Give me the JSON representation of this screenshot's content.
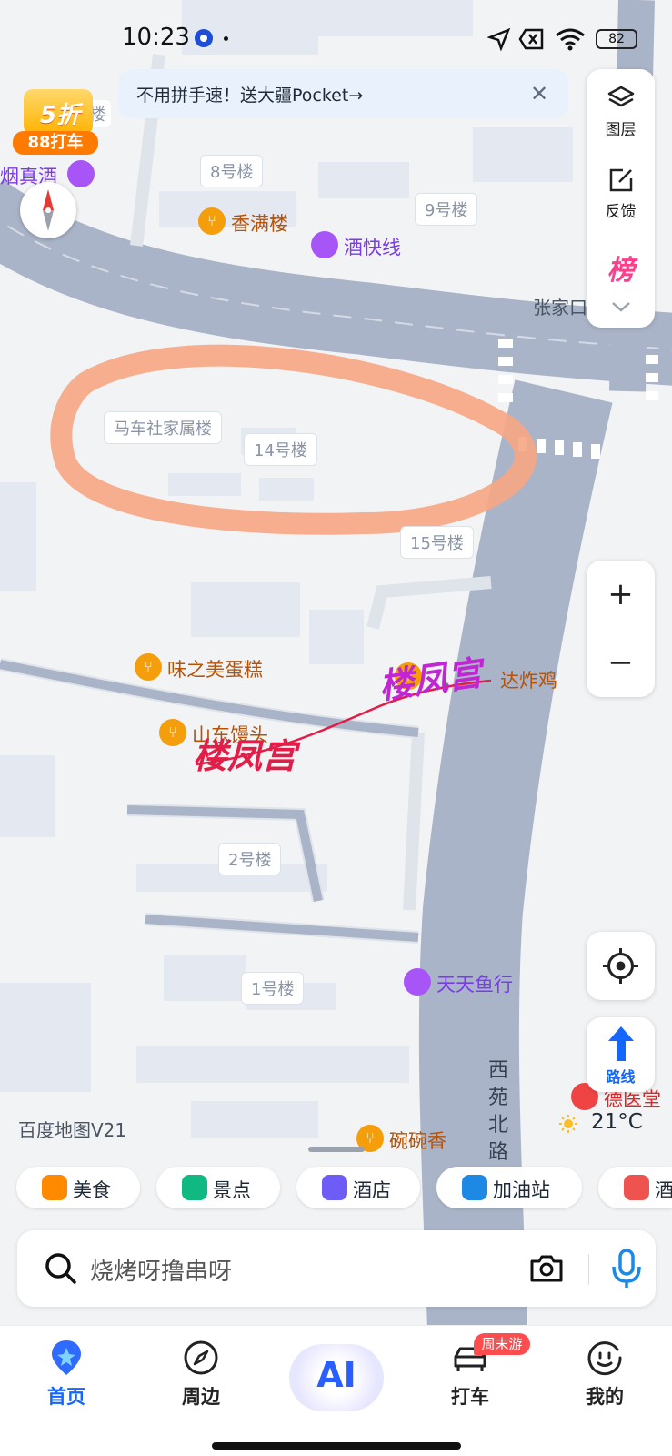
{
  "status": {
    "time": "10:23",
    "battery": "82"
  },
  "promo": {
    "discount": "5折",
    "label": "88打车"
  },
  "banner": {
    "text": "不用拼手速！送大疆Pocket→",
    "close": "✕"
  },
  "side_panel": {
    "layers_label": "图层",
    "feedback_label": "反馈",
    "rank_label": "榜"
  },
  "map": {
    "buildings": [
      {
        "name": "8号楼"
      },
      {
        "name": "9号楼"
      },
      {
        "name": "马车社家属楼"
      },
      {
        "name": "14号楼"
      },
      {
        "name": "15号楼"
      },
      {
        "name": "2号楼"
      },
      {
        "name": "1号楼"
      },
      {
        "name": "楼"
      }
    ],
    "pois": [
      {
        "name": "烟真酒"
      },
      {
        "name": "香满楼"
      },
      {
        "name": "酒快线"
      },
      {
        "name": "味之美蛋糕"
      },
      {
        "name": "山东馒头"
      },
      {
        "name": "达炸鸡"
      },
      {
        "name": "天天鱼行"
      },
      {
        "name": "德医堂"
      },
      {
        "name": "碗碗香"
      }
    ],
    "roads": [
      {
        "name": "张家口"
      },
      {
        "name": "西苑北路"
      }
    ],
    "annotations": [
      {
        "text": "楼凤宫"
      },
      {
        "text": "楼凤宫"
      }
    ]
  },
  "zoom": {
    "in": "+",
    "out": "−"
  },
  "route": {
    "label": "路线"
  },
  "weather": {
    "temp": "21°C"
  },
  "scale": {
    "text": "百度地图V21"
  },
  "chips": [
    {
      "label": "美食",
      "color": "#ff8a00"
    },
    {
      "label": "景点",
      "color": "#10b981"
    },
    {
      "label": "酒店",
      "color": "#6d5cf6"
    },
    {
      "label": "加油站",
      "color": "#1e88e5"
    },
    {
      "label": "酒",
      "color": "#ef5350"
    }
  ],
  "search": {
    "placeholder": "烧烤呀撸串呀"
  },
  "tabs": [
    {
      "label": "首页"
    },
    {
      "label": "周边"
    },
    {
      "label": "AI"
    },
    {
      "label": "打车"
    },
    {
      "label": "我的"
    }
  ],
  "weekend_badge": "周末游"
}
